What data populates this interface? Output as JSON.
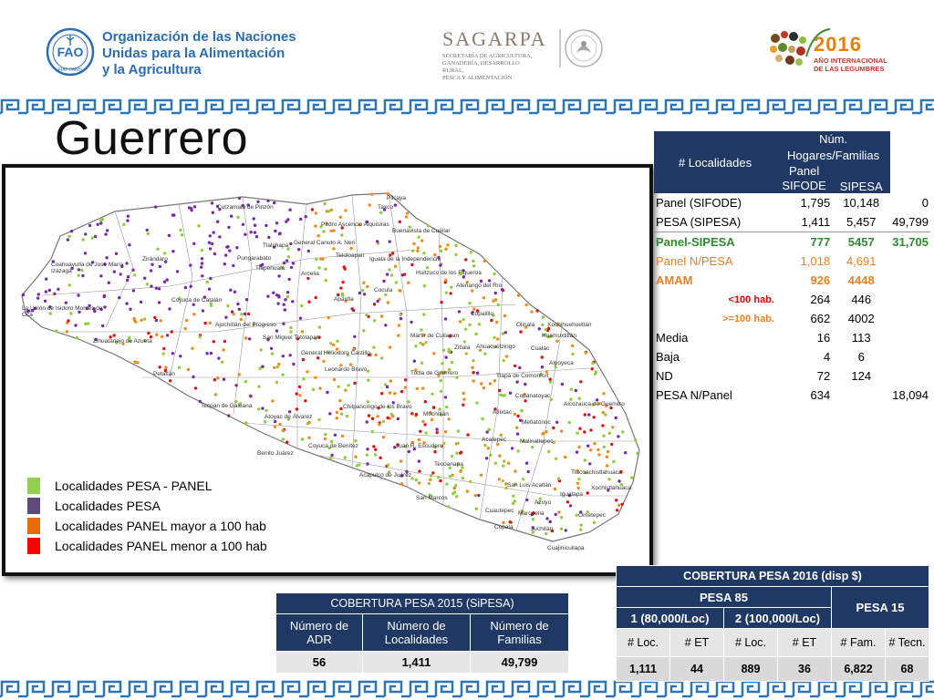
{
  "header": {
    "fao": {
      "logo_text": "FAO",
      "logo_sub": "FIAT PANIS",
      "lines": [
        "Organización de las Naciones",
        "Unidas para la Alimentación",
        "y la Agricultura"
      ]
    },
    "sagarpa": {
      "name": "SAGARPA",
      "sub": [
        "SECRETARÍA DE AGRICULTURA,",
        "GANADERÍA, DESARROLLO RURAL,",
        "PESCA Y ALIMENTACIÓN"
      ]
    },
    "legumbres": {
      "year": "2016",
      "lines": [
        "AÑO INTERNACIONAL",
        "DE LAS LEGUMBRES"
      ]
    }
  },
  "title": "Guerrero",
  "map": {
    "municipalities": [
      "Cutzamala de Pinzón",
      "Pilcaya",
      "Taxco",
      "Pedro Ascencio Alquisiras",
      "Buenavista de Cuéllar",
      "General Canuto A. Neri",
      "Tlalchapa",
      "Teloloapan",
      "Iguala de la Independencia",
      "Coahuayutla de José María Izazaga",
      "Zirándaro",
      "Pungarabato",
      "Tlapehuala",
      "Arcelia",
      "Huitzuco de los Figueroa",
      "Cocula",
      "Atenango del Río",
      "Apaxtla",
      "Coyuca de Catalán",
      "La Unión de Isidoro Montes de Oca",
      "Ajuchitlán del Progreso",
      "Copalillo",
      "Olinalá",
      "Xochihuehuetlán",
      "San Miguel Totolapan",
      "Mártir de Cuilapan",
      "Huamuxtitlán",
      "Zihuatanejo de Azueta",
      "General Heliodoro Castillo",
      "Zitlala",
      "Ahuacuotzingo",
      "Cualác",
      "Alpoyeca",
      "Leonardo Bravo",
      "Tixtla de Guerrero",
      "Tlapa de Comonfort",
      "Petatlán",
      "Copanatoyac",
      "Alcozauca de Guerrero",
      "Tecpan de Galeana",
      "Chilpancingo de los Bravo",
      "Mochitlán",
      "Atlixtac",
      "Atoyac de Álvarez",
      "Metlatónoc",
      "Tlacoachistlahuaca",
      "Benito Juárez",
      "Coyuca de Benítez",
      "Juan R. Escudero",
      "Acatepec",
      "Malinaltepec",
      "Tecoanapa",
      "Xochistlahuaca",
      "Acapulco de Juárez",
      "San Luis Acatlán",
      "San Marcos",
      "Igualapa",
      "Azoyú",
      "Cuautepec",
      "Marquelia",
      "Ometepec",
      "Copala",
      "Juchitán",
      "Cuajinicuilapa"
    ],
    "dot_colors": {
      "green": "#8fce3a",
      "purple": "#7a2aa8",
      "orange": "#f08a1c",
      "red": "#e01010"
    }
  },
  "legend": [
    {
      "label": "Localidades PESA - PANEL",
      "color": "#92d050"
    },
    {
      "label": "Localidades PESA",
      "color": "#604a7b"
    },
    {
      "label": "Localidades PANEL mayor a 100 hab",
      "color": "#e36c09"
    },
    {
      "label": "Localidades PANEL menor a 100 hab",
      "color": "#ff0000"
    }
  ],
  "summary_table": {
    "header": {
      "localidades": "# Localidades",
      "hogares": "Núm. Hogares/Familias",
      "panel_sifode": "Panel SIFODE",
      "sipesa": "SIPESA"
    },
    "rows": [
      {
        "label": "Panel (SIFODE)",
        "loc": "1,795",
        "panel": "10,148",
        "sipesa": "0",
        "style": "plain"
      },
      {
        "label": "PESA (SIPESA)",
        "loc": "1,411",
        "panel": "5,457",
        "sipesa": "49,799",
        "style": "plain"
      },
      {
        "label": "Panel-SIPESA",
        "loc": "777",
        "panel": "5457",
        "sipesa": "31,705",
        "style": "green"
      },
      {
        "label": "Panel N/PESA",
        "loc": "1,018",
        "panel": "4,691",
        "sipesa": "",
        "style": "orange"
      },
      {
        "label": "AMAM",
        "loc": "926",
        "panel": "4448",
        "sipesa": "",
        "style": "orange-b"
      },
      {
        "label": "<100 hab.",
        "loc": "264",
        "panel": "446",
        "sipesa": "",
        "style": "red-s"
      },
      {
        "label": ">=100 hab.",
        "loc": "662",
        "panel": "4002",
        "sipesa": "",
        "style": "orange-s"
      },
      {
        "label": "Media",
        "loc": "16",
        "panel": "113",
        "sipesa": "",
        "style": "plain"
      },
      {
        "label": "Baja",
        "loc": "4",
        "panel": "6",
        "sipesa": "",
        "style": "plain"
      },
      {
        "label": "ND",
        "loc": "72",
        "panel": "124",
        "sipesa": "",
        "style": "plain"
      },
      {
        "label": "PESA N/Panel",
        "loc": "634",
        "panel": "",
        "sipesa": "18,094",
        "style": "plain"
      }
    ]
  },
  "cobertura_2015": {
    "title": "COBERTURA  PESA 2015 (SiPESA)",
    "headers": [
      "Número de ADR",
      "Número de Localidades",
      "Número de Familias"
    ],
    "values": [
      "56",
      "1,411",
      "49,799"
    ]
  },
  "cobertura_2016": {
    "title": "COBERTURA PESA 2016 (disp $)",
    "pesa85": "PESA 85",
    "pesa15": "PESA 15",
    "group1": "1 (80,000/Loc)",
    "group2": "2 (100,000/Loc)",
    "subheaders": [
      "#  Loc.",
      "# ET",
      "# Loc.",
      "# ET",
      "# Fam.",
      "# Tecn."
    ],
    "values": [
      "1,111",
      "44",
      "889",
      "36",
      "6,822",
      "68"
    ]
  }
}
